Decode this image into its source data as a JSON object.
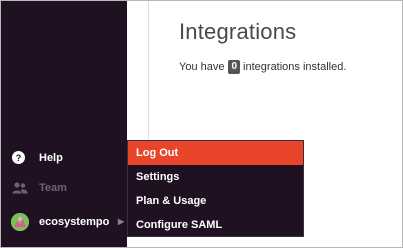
{
  "main": {
    "title": "Integrations",
    "summary_prefix": "You have",
    "integration_count": "0",
    "summary_suffix": "integrations installed."
  },
  "sidebar": {
    "help_label": "Help",
    "team_label": "Team",
    "user_label": "ecosystempo"
  },
  "user_menu": {
    "items": [
      {
        "label": "Log Out",
        "active": true
      },
      {
        "label": "Settings"
      },
      {
        "label": "Plan & Usage"
      },
      {
        "label": "Configure SAML"
      }
    ]
  },
  "colors": {
    "sidebar_bg": "#1f1122",
    "accent": "#e8452b",
    "avatar_bg": "#79c05a"
  },
  "icons": [
    "question-circle-icon",
    "team-icon",
    "avatar-icon",
    "chevron-right-icon"
  ]
}
